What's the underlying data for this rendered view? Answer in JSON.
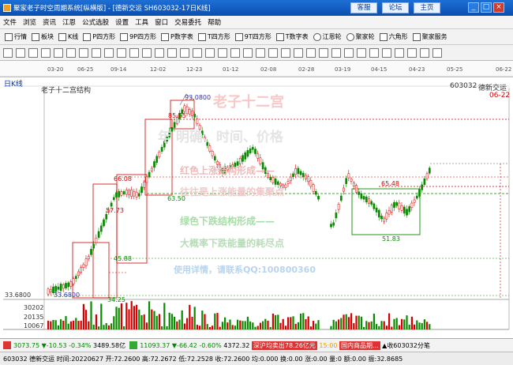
{
  "window": {
    "title": "聚家老子时空周期系统[纵横版] - [德新交运 SH603032-17日K线]",
    "buttons": [
      "客服",
      "论坛",
      "主页"
    ],
    "win_controls": [
      "_",
      "□",
      "×"
    ]
  },
  "menu": [
    "文件",
    "浏览",
    "资讯",
    "江恩",
    "公式选股",
    "设置",
    "工具",
    "窗口",
    "交易委托",
    "帮助"
  ],
  "toolbar1": [
    "行情",
    "板块",
    "K线",
    "P四方形",
    "9P四方形",
    "P数字表",
    "T四方形",
    "9T四方形",
    "T数字表",
    "江恩轮",
    "聚家轮",
    "六角形",
    "聚家服务"
  ],
  "toolbar2": {
    "icons": [
      "arrow-left-icon",
      "arrow-right-icon",
      "zoom-in-icon",
      "zoom-out-icon",
      "cycle-icon",
      "line-icon",
      "rect-icon",
      "text-icon",
      "fib-icon",
      "gann-icon",
      "cross-icon",
      "delete-icon",
      "lock-icon",
      "ruler-icon",
      "eye-icon",
      "pen-icon",
      "fan-icon",
      "grid-icon",
      "circle-icon",
      "spiral-icon",
      "arc-icon",
      "time-icon",
      "price-icon",
      "box-icon",
      "angle-icon",
      "wave-icon",
      "star-icon",
      "target-icon",
      "dot-icon",
      "bar-icon",
      "list-icon",
      "copy-icon",
      "save-icon",
      "print-icon",
      "help-icon"
    ]
  },
  "dates": [
    "03-20",
    "06-25",
    "09-14",
    "12-02",
    "12-23",
    "01-12",
    "02-08",
    "02-28",
    "03-19",
    "04-15",
    "04-23",
    "05-25",
    "06-22"
  ],
  "chart": {
    "period": "日K线",
    "indicator": "老子十二宫结构",
    "code": "603032",
    "name": "德新交运",
    "date_right": "06-22",
    "watermark": [
      "老子十二宫",
      "年 明确、时间、价格",
      "红色上涨结构形成——",
      "往往是上涨能量的集聚点",
      "绿色下跌结构形成——",
      "大概率下跌能量的耗尽点",
      "使用详情，请联系QQ:100800360"
    ],
    "price_labels": [
      "93.0800",
      "85.65",
      "66.08",
      "63.50",
      "57.73",
      "45.88",
      "34.25",
      "33.6800",
      "65.48",
      "51.83"
    ],
    "y_label_left": "33.6800",
    "volume_ticks": [
      "30202",
      "20135",
      "10067"
    ],
    "colors": {
      "up": "#d30000",
      "down": "#0a8a00",
      "box_red": "#d30000",
      "box_green": "#0a8a00"
    }
  },
  "status": {
    "idx1": "3073.75",
    "chg1": "▼-10.53",
    "pct1": "-0.34%",
    "amt1": "3489.58亿",
    "idx2": "11093.37",
    "chg2": "▼-66.42",
    "pct2": "-0.60%",
    "amt2": "4372.32",
    "scroll": "深沪均卖出78.26亿元",
    "time": "15:00",
    "market": "国内商品期...",
    "alert": "收603032分笔"
  },
  "bottom": {
    "code": "603032",
    "name": "德新交运",
    "info": "时间:20220627  开:72.2600  高:72.2672  低:72.2528  收:72.2600  均:0.000  换:0.00  涨:0.00  量:0  额:0.00  振:32.8685"
  }
}
